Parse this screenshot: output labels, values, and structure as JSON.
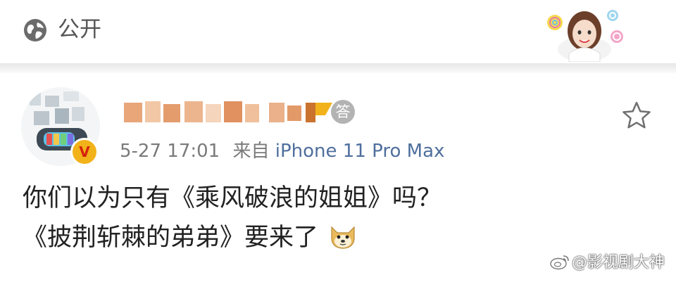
{
  "topbar": {
    "visibility_label": "公开",
    "icon": "globe-icon"
  },
  "post": {
    "author": {
      "name": "",
      "avatar_icon": "avatar",
      "verified_badge": "V",
      "answer_badge": "答"
    },
    "meta": {
      "date": "5-27",
      "time": "17:01",
      "source_prefix": "来自",
      "source": "iPhone 11 Pro Max"
    },
    "content": {
      "line1": "你们以为只有《乘风破浪的姐姐》吗？",
      "line2": "《披荆斩棘的弟弟》要来了"
    },
    "favorite_icon": "star-icon"
  },
  "watermark": {
    "text": "@影视剧大神"
  },
  "colors": {
    "link": "#4f6f9d",
    "meta": "#7a7a7a",
    "badge_gold": "#f2b21a"
  }
}
